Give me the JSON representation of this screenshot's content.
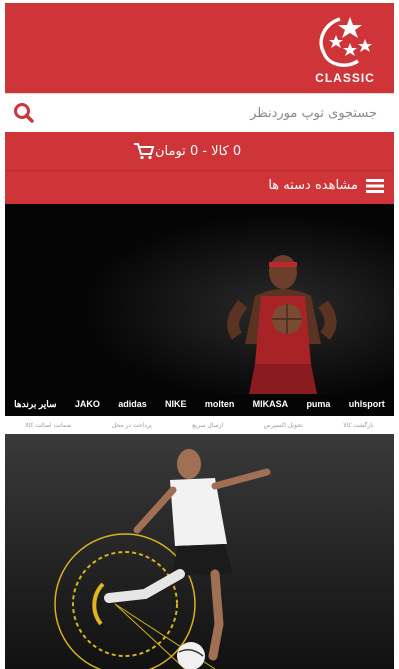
{
  "header": {
    "logo_text": "CLASSIC"
  },
  "search": {
    "placeholder": "جستجوی توپ موردنظر"
  },
  "cart": {
    "summary": "0 کالا - 0 تومان"
  },
  "categories": {
    "label": "مشاهده دسته ها"
  },
  "banner_brands": [
    "uhlsport",
    "puma",
    "MIKASA",
    "molten",
    "NIKE",
    "adidas",
    "JAKO",
    "سایر برندها"
  ],
  "feature_strip": [
    "ضمانت اصالت کالا",
    "پرداخت در محل",
    "ارسال سریع",
    "تحویل اکسپرس",
    "بازگشت کالا"
  ],
  "icons": {
    "search": "search-icon",
    "cart": "cart-icon",
    "menu": "menu-icon",
    "logo": "soccer-ball-stars-logo-icon"
  },
  "colors": {
    "brand_red": "#cf3438",
    "banner_bg": "#050505"
  }
}
